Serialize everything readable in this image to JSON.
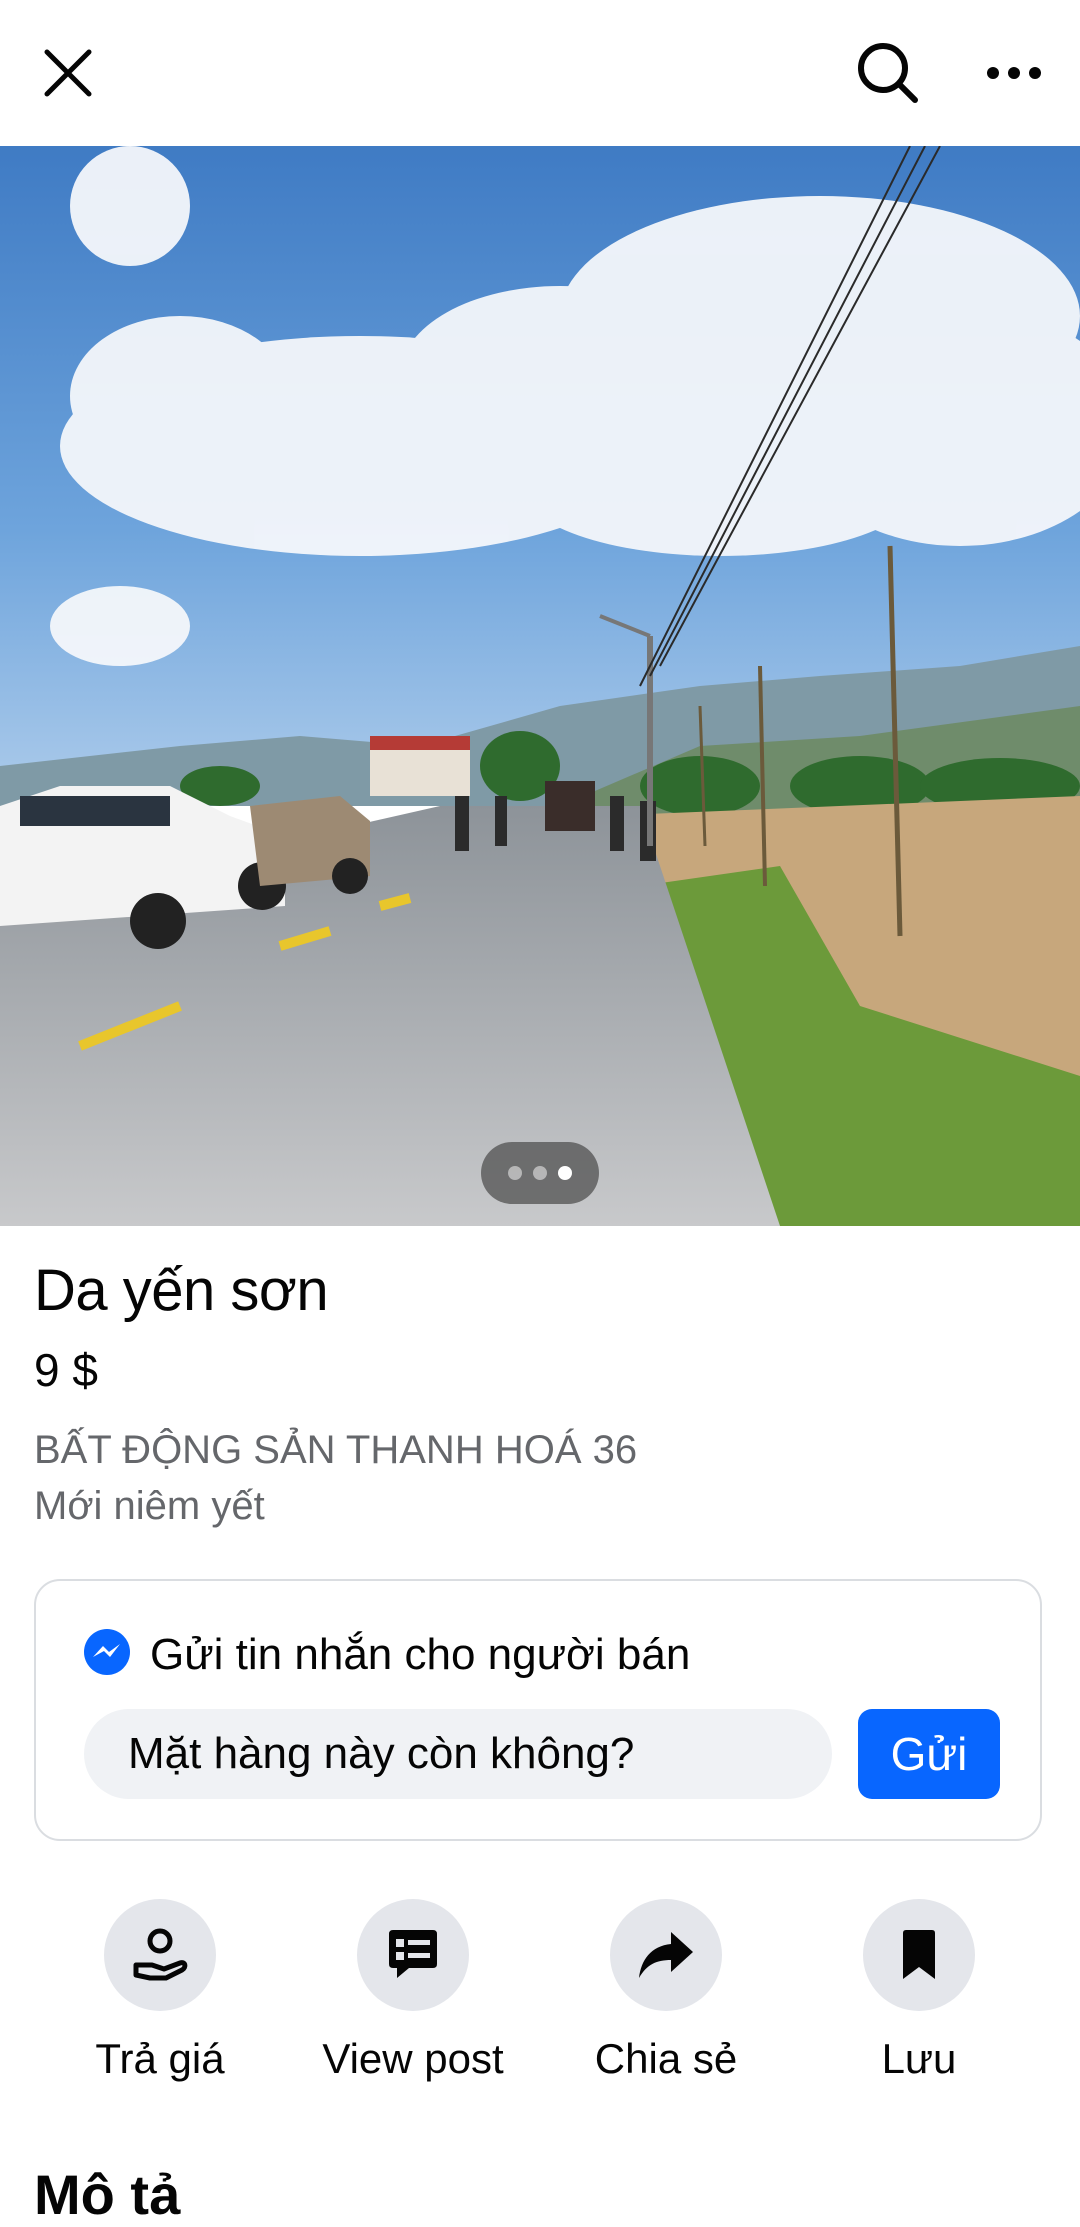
{
  "topbar": {
    "close_icon": "close-icon",
    "search_icon": "search-icon",
    "more_icon": "more-horizontal-icon"
  },
  "hero": {
    "image_description": "Photo of a rural paved road with parked cars, people standing, power lines and open fields under a blue sky",
    "pager": {
      "count": 3,
      "active_index": 2
    }
  },
  "listing": {
    "title": "Da yến sơn",
    "price": "9 $",
    "seller": "BẤT ĐỘNG SẢN THANH HOÁ 36",
    "status": "Mới niêm yết"
  },
  "message_card": {
    "icon": "messenger-icon",
    "heading": "Gửi tin nhắn cho người bán",
    "input_value": "Mặt hàng này còn không?",
    "send_label": "Gửi",
    "send_color": "#0866ff"
  },
  "actions": [
    {
      "label": "Trả giá",
      "icon": "offer-hand-icon"
    },
    {
      "label": "View post",
      "icon": "post-icon"
    },
    {
      "label": "Chia sẻ",
      "icon": "share-icon"
    },
    {
      "label": "Lưu",
      "icon": "bookmark-icon"
    }
  ],
  "description": {
    "heading": "Mô tả"
  }
}
